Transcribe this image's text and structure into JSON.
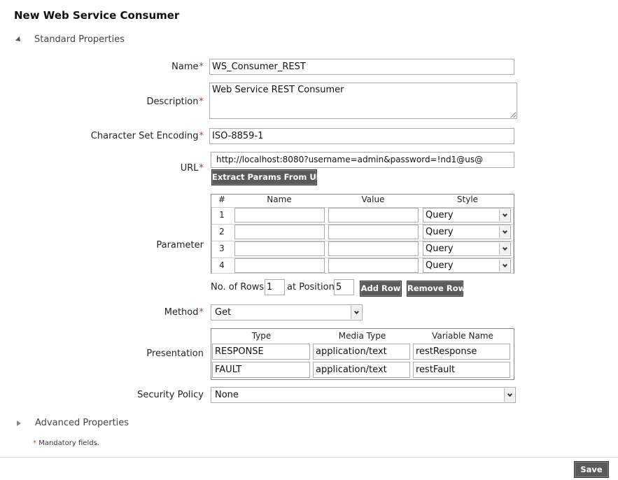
{
  "page": {
    "title": "New Web Service Consumer"
  },
  "sections": {
    "standard": "Standard Properties",
    "advanced": "Advanced Properties"
  },
  "form": {
    "name": {
      "label": "Name",
      "value": "WS_Consumer_REST"
    },
    "description": {
      "label": "Description",
      "value": "Web Service REST Consumer"
    },
    "encoding": {
      "label": "Character Set Encoding",
      "value": "ISO-8859-1"
    },
    "url": {
      "label": "URL",
      "value": "http://localhost:8080?username=admin&password=!nd1@us@"
    },
    "extract_button": "Extract Params From URL",
    "parameter": {
      "label": "Parameter",
      "headers": {
        "num": "#",
        "name": "Name",
        "value": "Value",
        "style": "Style"
      },
      "rows": [
        {
          "num": "1",
          "name": "",
          "value": "",
          "style": "Query"
        },
        {
          "num": "2",
          "name": "",
          "value": "",
          "style": "Query"
        },
        {
          "num": "3",
          "name": "",
          "value": "",
          "style": "Query"
        },
        {
          "num": "4",
          "name": "",
          "value": "",
          "style": "Query"
        }
      ]
    },
    "rows_control": {
      "rows_label": "No. of Rows",
      "rows_value": "1",
      "position_label": "at Position",
      "position_value": "5",
      "add_button": "Add Row",
      "remove_button": "Remove Row"
    },
    "method": {
      "label": "Method",
      "value": "Get"
    },
    "presentation": {
      "label": "Presentation",
      "headers": {
        "type": "Type",
        "media": "Media Type",
        "variable": "Variable Name"
      },
      "rows": [
        {
          "type": "RESPONSE",
          "media": "application/text",
          "variable": "restResponse"
        },
        {
          "type": "FAULT",
          "media": "application/text",
          "variable": "restFault"
        }
      ]
    },
    "security": {
      "label": "Security Policy",
      "value": "None"
    },
    "required_marker": "*"
  },
  "footer": {
    "mandatory_note": "Mandatory fields.",
    "save_button": "Save"
  },
  "colors": {
    "required": "#c0392b",
    "button": "#5a5a5a"
  }
}
